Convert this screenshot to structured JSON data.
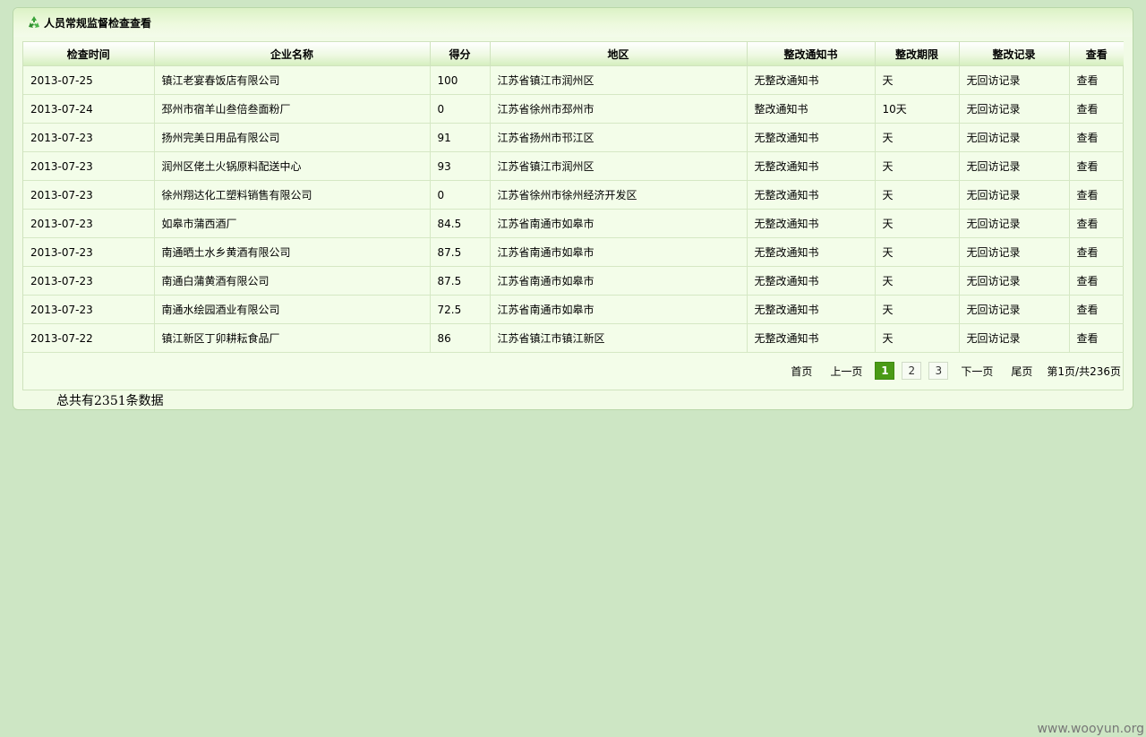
{
  "panel": {
    "title": "人员常规监督检查查看",
    "icon": "recycle-icon"
  },
  "table": {
    "columns": [
      "检查时间",
      "企业名称",
      "得分",
      "地区",
      "整改通知书",
      "整改期限",
      "整改记录",
      "查看"
    ],
    "rows": [
      [
        "2013-07-25",
        "镇江老宴春饭店有限公司",
        "100",
        "江苏省镇江市润州区",
        "无整改通知书",
        "天",
        "无回访记录",
        "查看"
      ],
      [
        "2013-07-24",
        "邳州市宿羊山叁倍叁面粉厂",
        "0",
        "江苏省徐州市邳州市",
        "整改通知书",
        "10天",
        "无回访记录",
        "查看"
      ],
      [
        "2013-07-23",
        "扬州完美日用品有限公司",
        "91",
        "江苏省扬州市邗江区",
        "无整改通知书",
        "天",
        "无回访记录",
        "查看"
      ],
      [
        "2013-07-23",
        "润州区佬土火锅原料配送中心",
        "93",
        "江苏省镇江市润州区",
        "无整改通知书",
        "天",
        "无回访记录",
        "查看"
      ],
      [
        "2013-07-23",
        "徐州翔达化工塑料销售有限公司",
        "0",
        "江苏省徐州市徐州经济开发区",
        "无整改通知书",
        "天",
        "无回访记录",
        "查看"
      ],
      [
        "2013-07-23",
        "如皋市蒲西酒厂",
        "84.5",
        "江苏省南通市如皋市",
        "无整改通知书",
        "天",
        "无回访记录",
        "查看"
      ],
      [
        "2013-07-23",
        "南通晒土水乡黄酒有限公司",
        "87.5",
        "江苏省南通市如皋市",
        "无整改通知书",
        "天",
        "无回访记录",
        "查看"
      ],
      [
        "2013-07-23",
        "南通白蒲黄酒有限公司",
        "87.5",
        "江苏省南通市如皋市",
        "无整改通知书",
        "天",
        "无回访记录",
        "查看"
      ],
      [
        "2013-07-23",
        "南通水绘园酒业有限公司",
        "72.5",
        "江苏省南通市如皋市",
        "无整改通知书",
        "天",
        "无回访记录",
        "查看"
      ],
      [
        "2013-07-22",
        "镇江新区丁卯耕耘食品厂",
        "86",
        "江苏省镇江市镇江新区",
        "无整改通知书",
        "天",
        "无回访记录",
        "查看"
      ]
    ]
  },
  "pager": {
    "first": "首页",
    "prev": "上一页",
    "pages": [
      "1",
      "2",
      "3"
    ],
    "current": "1",
    "next": "下一页",
    "last": "尾页",
    "info": "第1页/共236页"
  },
  "total": "总共有2351条数据",
  "watermark": "www.wooyun.org"
}
